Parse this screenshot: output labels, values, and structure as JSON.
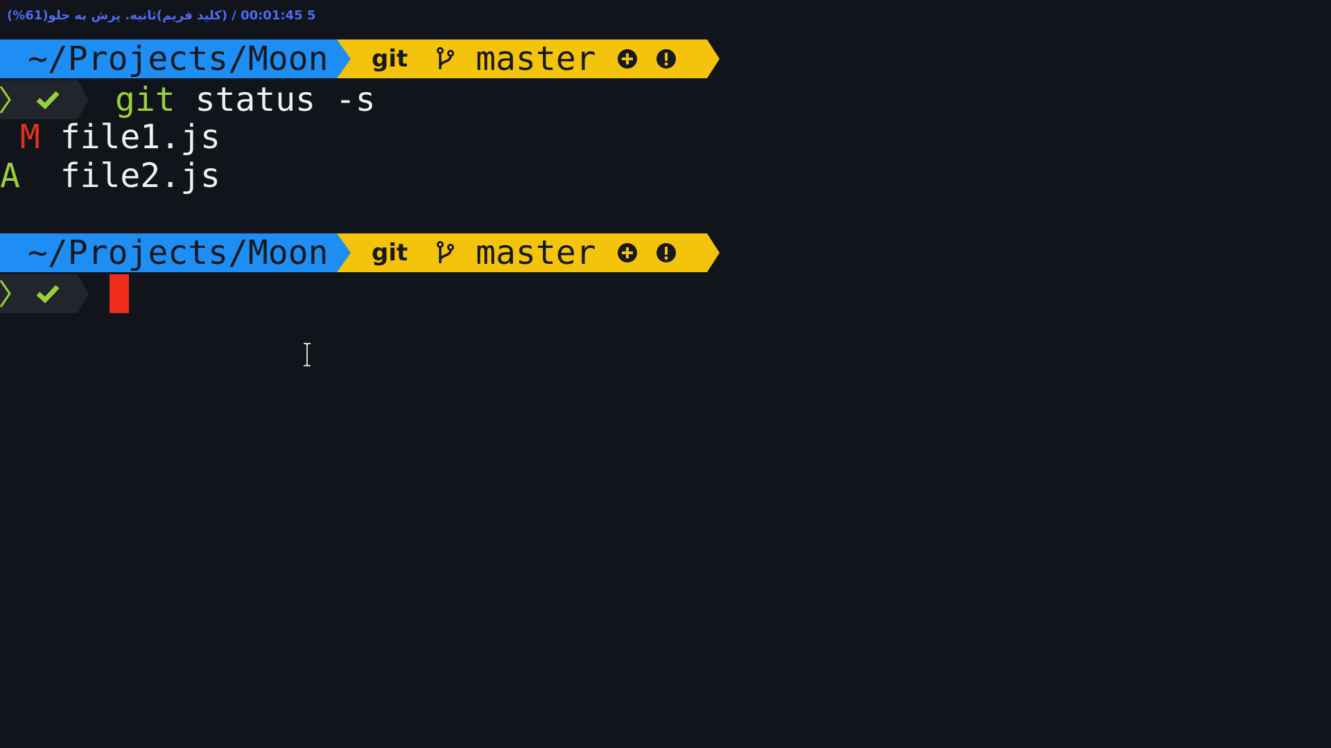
{
  "overlay": {
    "text": "5 00:01:45 / (کلید فریم)ثانیه. پرش به جلو(61%)"
  },
  "prompt1": {
    "path": "~/Projects/Moon",
    "vcs": "git",
    "branch": "master"
  },
  "line_command": {
    "git_word": "git",
    "rest": " status -s"
  },
  "status_output": [
    {
      "code": " M",
      "file": " file1.js"
    },
    {
      "code": "A ",
      "file": " file2.js"
    }
  ],
  "prompt2": {
    "path": "~/Projects/Moon",
    "vcs": "git",
    "branch": "master"
  },
  "colors": {
    "background": "#12141b",
    "path_segment": "#1e8ef5",
    "git_segment": "#f4c30c",
    "modified": "#e0341e",
    "added": "#98d13a",
    "cursor": "#f02b1a"
  },
  "icons": [
    "folder-open-icon",
    "branch-icon",
    "plus-circle-icon",
    "exclamation-circle-icon",
    "chevron-right-icon",
    "checkmark-icon",
    "ibeam-cursor-icon"
  ]
}
